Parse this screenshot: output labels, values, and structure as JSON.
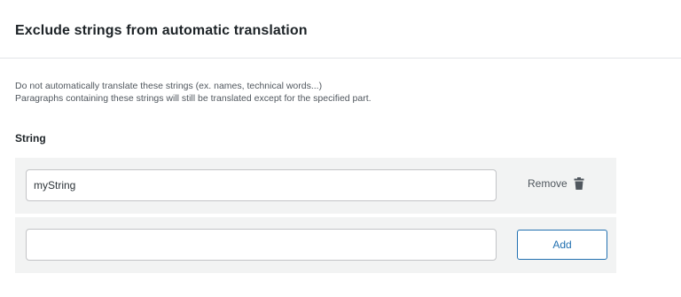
{
  "section": {
    "title": "Exclude strings from automatic translation",
    "description_line1": "Do not automatically translate these strings (ex. names, technical words...)",
    "description_line2": "Paragraphs containing these strings will still be translated except for the specified part."
  },
  "table": {
    "column_label": "String",
    "rows": [
      {
        "value": "myString",
        "remove_label": "Remove"
      }
    ],
    "new_row": {
      "value": "",
      "add_label": "Add"
    }
  },
  "icons": {
    "remove": "trash-icon"
  },
  "colors": {
    "accent": "#2271b1",
    "row_background": "#f2f3f3",
    "divider": "#e2e4e7"
  }
}
